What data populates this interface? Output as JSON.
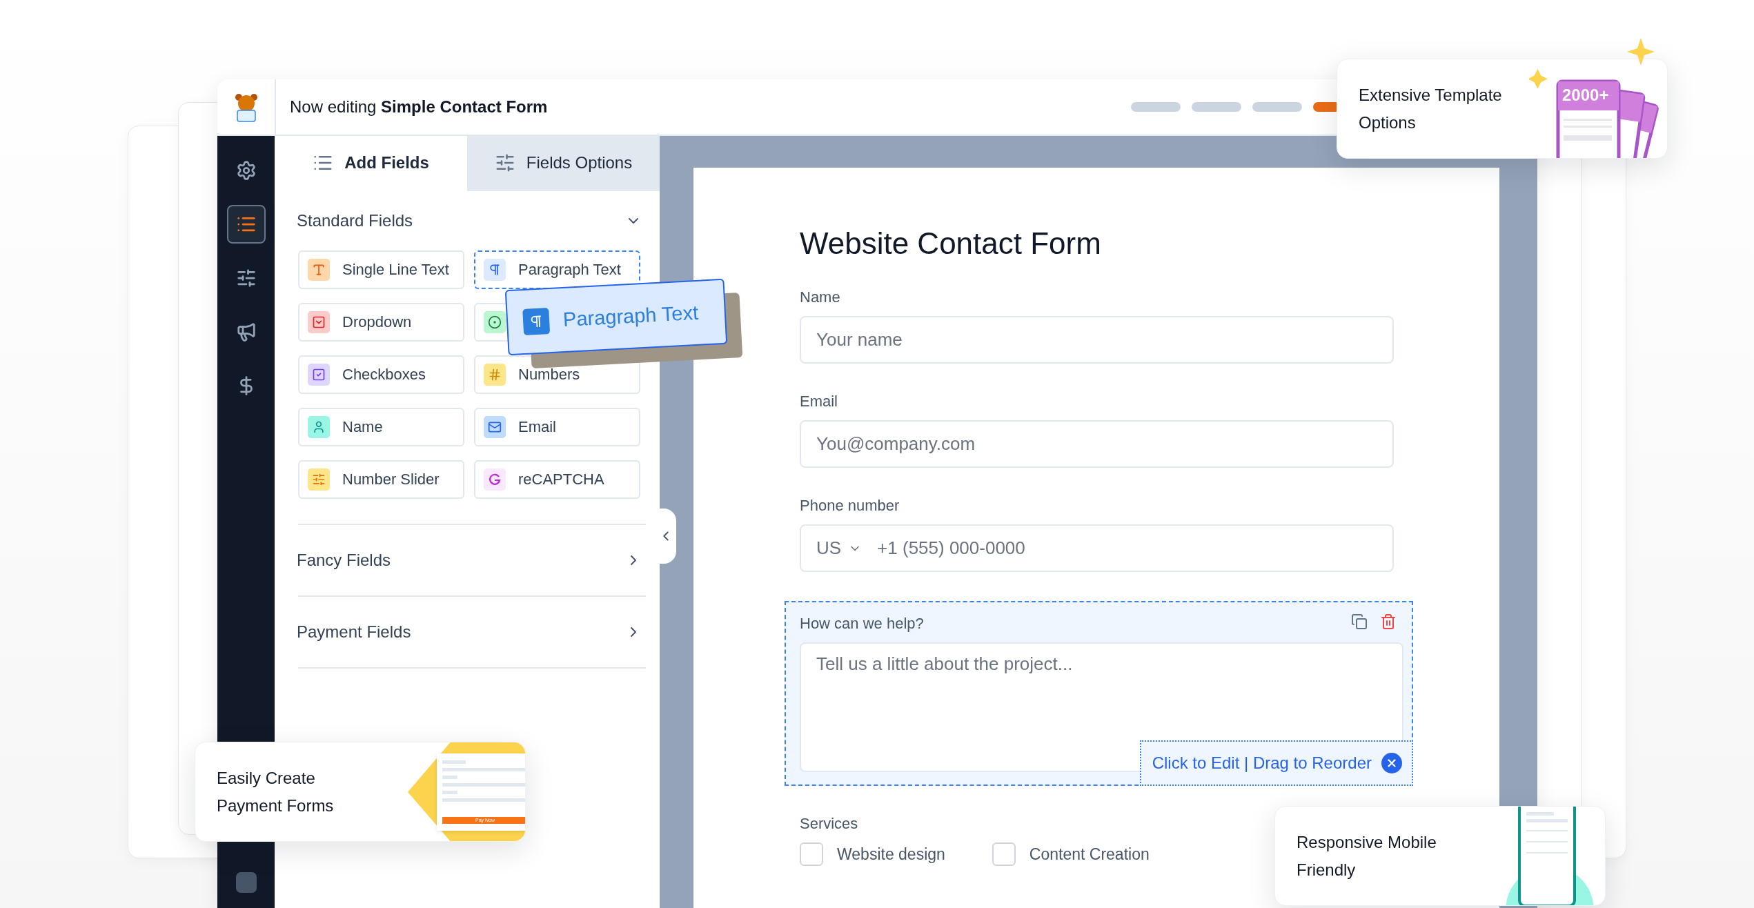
{
  "header": {
    "prefix": "Now editing",
    "form_name": "Simple Contact Form"
  },
  "progress_steps": [
    {
      "selected": false
    },
    {
      "selected": false
    },
    {
      "selected": false
    },
    {
      "selected": true
    }
  ],
  "sidebar": [
    {
      "kind": "settings",
      "selected": false
    },
    {
      "kind": "fields",
      "selected": true
    },
    {
      "kind": "options",
      "selected": false
    },
    {
      "kind": "marketing",
      "selected": false
    },
    {
      "kind": "payments",
      "selected": false
    }
  ],
  "panel_tabs": [
    {
      "label": "Add Fields",
      "kind": "fields",
      "selected": true
    },
    {
      "label": "Fields Options",
      "kind": "options",
      "selected": false
    }
  ],
  "standard_fields": {
    "title": "Standard Fields",
    "expanded": true,
    "items": [
      {
        "kind": "single_line",
        "label": "Single Line Text",
        "color": "#fed7aa",
        "dragging": false
      },
      {
        "kind": "paragraph",
        "label": "Paragraph Text",
        "color": "#dbeafe",
        "dragging": true
      },
      {
        "kind": "dropdown",
        "label": "Dropdown",
        "color": "#fecaca",
        "dragging": false
      },
      {
        "kind": "radio",
        "color": "#bbf7d0",
        "dragging": false
      },
      {
        "kind": "checkboxes",
        "label": "Checkboxes",
        "color": "#ddd6fe",
        "dragging": false
      },
      {
        "kind": "numbers",
        "label": "Numbers",
        "color": "#fde68a",
        "dragging": false
      },
      {
        "kind": "name",
        "label": "Name",
        "color": "#99f6e4",
        "dragging": false
      },
      {
        "kind": "email",
        "label": "Email",
        "color": "#bfdbfe",
        "dragging": false
      },
      {
        "kind": "slider",
        "label": "Number Slider",
        "color": "#fde68a",
        "dragging": false
      },
      {
        "kind": "recaptcha",
        "label": "reCAPTCHA",
        "color": "#fae8ff",
        "dragging": false
      }
    ]
  },
  "drag_ghost": {
    "label": "Paragraph Text"
  },
  "sections": [
    {
      "title": "Fancy Fields",
      "expanded": false
    },
    {
      "title": "Payment Fields",
      "expanded": false
    }
  ],
  "form": {
    "title": "Website Contact Form",
    "fields": [
      {
        "kind": "text",
        "label": "Name",
        "placeholder": "Your name",
        "selected": false
      },
      {
        "kind": "text",
        "label": "Email",
        "placeholder": "You@company.com",
        "selected": false
      },
      {
        "kind": "phone",
        "label": "Phone number",
        "country": "US",
        "placeholder": "+1 (555) 000-0000",
        "selected": false
      },
      {
        "kind": "textarea",
        "label": "How can we help?",
        "placeholder": "Tell us a little about the project...",
        "hint": "Click to Edit | Drag to Reorder",
        "selected": true
      },
      {
        "kind": "checkboxes",
        "label": "Services",
        "selected": false,
        "options": [
          {
            "label": "Website design",
            "checked": false
          },
          {
            "label": "Content Creation",
            "checked": false
          }
        ]
      }
    ]
  },
  "promo_cards": [
    {
      "kind": "templates",
      "lines": [
        "Extensive Template",
        "Options"
      ],
      "badge": "2000+"
    },
    {
      "kind": "payments",
      "lines": [
        "Easily Create",
        "Payment Forms"
      ],
      "button": "Pay Now"
    },
    {
      "kind": "mobile",
      "lines": [
        "Responsive Mobile",
        "Friendly"
      ]
    }
  ]
}
